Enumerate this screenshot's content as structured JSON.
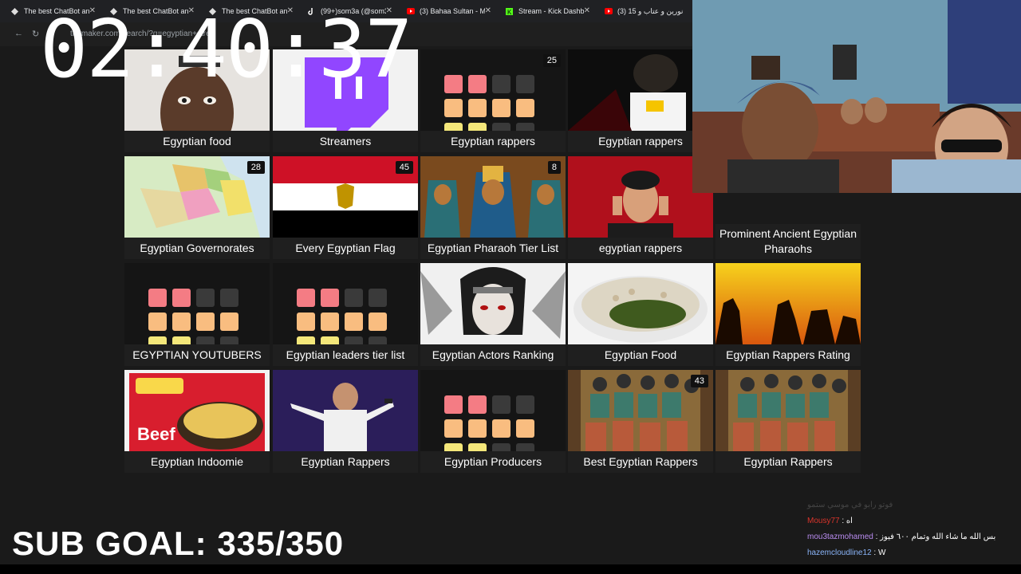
{
  "browser": {
    "tabs": [
      {
        "label": "The best ChatBot and",
        "icon": "chatbot-icon"
      },
      {
        "label": "The best ChatBot and",
        "icon": "chatbot-icon"
      },
      {
        "label": "The best ChatBot and",
        "icon": "chatbot-icon"
      },
      {
        "label": "(99+)som3a (@som3",
        "icon": "tiktok-icon"
      },
      {
        "label": "(3) Bahaa Sultan - M",
        "icon": "youtube-icon"
      },
      {
        "label": "Stream - Kick Dashbo",
        "icon": "kick-icon"
      },
      {
        "label": "(3) نورين و عتاب و 15",
        "icon": "youtube-icon"
      }
    ],
    "url": "tiermaker.com/search/?q=egyptian+strea"
  },
  "overlay": {
    "clock": "02:40:37",
    "sub_goal": "SUB GOAL: 335/350"
  },
  "grid": {
    "cards": [
      {
        "label": "Egyptian food",
        "badge": ""
      },
      {
        "label": "Streamers",
        "badge": ""
      },
      {
        "label": "Egyptian rappers",
        "badge": "25"
      },
      {
        "label": "Egyptian rappers",
        "badge": ""
      },
      {
        "label": "Egyptian Governorates",
        "badge": "28"
      },
      {
        "label": "Every Egyptian Flag",
        "badge": "45"
      },
      {
        "label": "Egyptian Pharaoh Tier List",
        "badge": "8"
      },
      {
        "label": "egyptian rappers",
        "badge": ""
      },
      {
        "label": "Prominent Ancient Egyptian Pharaohs",
        "badge": ""
      },
      {
        "label": "EGYPTIAN YOUTUBERS",
        "badge": ""
      },
      {
        "label": "Egyptian leaders tier list",
        "badge": ""
      },
      {
        "label": "Egyptian Actors Ranking",
        "badge": ""
      },
      {
        "label": "Egyptian Food",
        "badge": ""
      },
      {
        "label": "Egyptian Rappers Rating",
        "badge": ""
      },
      {
        "label": "Egyptian Indoomie",
        "badge": ""
      },
      {
        "label": "Egyptian Rappers",
        "badge": ""
      },
      {
        "label": "Egyptian Producers",
        "badge": ""
      },
      {
        "label": "Best Egyptian Rappers",
        "badge": "43"
      },
      {
        "label": "Egyptian Rappers",
        "badge": ""
      }
    ]
  },
  "chat": {
    "messages": [
      {
        "user": "",
        "text": "فوتو رابو في موسي ستمو"
      },
      {
        "user": "Mousy77",
        "text": "اه"
      },
      {
        "user": "mou3tazmohamed",
        "text": "بس الله ما شاء الله وتمام ٦٠٠ فيوز"
      },
      {
        "user": "hazemcloudline12",
        "text": "W"
      }
    ],
    "colors": {
      "mousy": "#d9342b",
      "mou3taz": "#b98cf0",
      "hazem": "#8ab4f8"
    }
  }
}
